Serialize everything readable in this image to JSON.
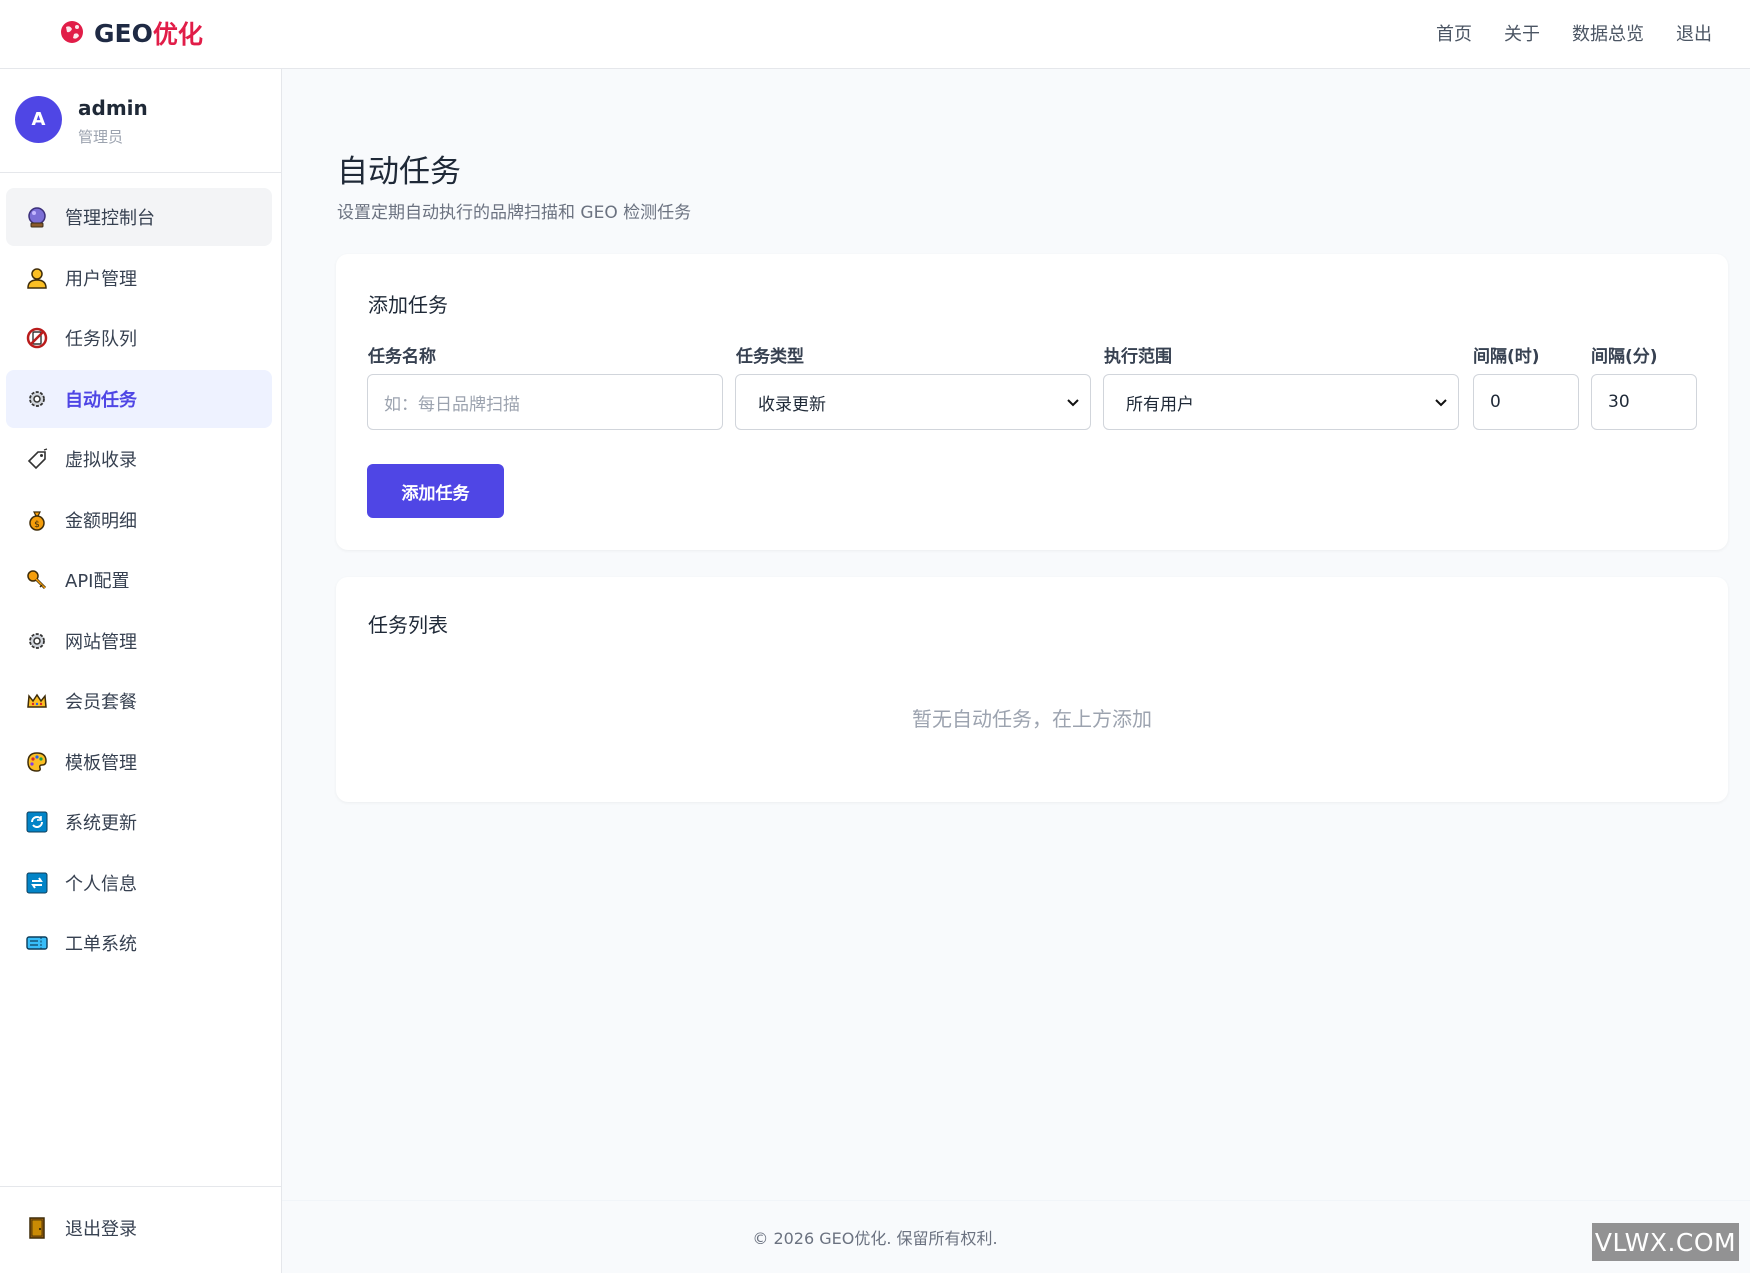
{
  "header": {
    "logo_text": "GEO",
    "logo_text_accent": "优化",
    "nav": [
      "首页",
      "关于",
      "数据总览",
      "退出"
    ]
  },
  "user": {
    "avatar_letter": "A",
    "name": "admin",
    "role": "管理员"
  },
  "sidebar": {
    "items": [
      {
        "label": "管理控制台",
        "icon": "crystal-ball-icon",
        "state": "hover"
      },
      {
        "label": "用户管理",
        "icon": "user-icon",
        "state": ""
      },
      {
        "label": "任务队列",
        "icon": "no-entry-icon",
        "state": ""
      },
      {
        "label": "自动任务",
        "icon": "gear-icon",
        "state": "active"
      },
      {
        "label": "虚拟收录",
        "icon": "tag-icon",
        "state": ""
      },
      {
        "label": "金额明细",
        "icon": "money-bag-icon",
        "state": ""
      },
      {
        "label": "API配置",
        "icon": "key-icon",
        "state": ""
      },
      {
        "label": "网站管理",
        "icon": "gear-icon",
        "state": ""
      },
      {
        "label": "会员套餐",
        "icon": "crown-icon",
        "state": ""
      },
      {
        "label": "模板管理",
        "icon": "palette-icon",
        "state": ""
      },
      {
        "label": "系统更新",
        "icon": "refresh-icon",
        "state": ""
      },
      {
        "label": "个人信息",
        "icon": "repeat-icon",
        "state": ""
      },
      {
        "label": "工单系统",
        "icon": "ticket-icon",
        "state": ""
      }
    ],
    "logout_label": "退出登录"
  },
  "main": {
    "title": "自动任务",
    "subtitle": "设置定期自动执行的品牌扫描和 GEO 检测任务",
    "add_card": {
      "title": "添加任务",
      "task_name_label": "任务名称",
      "task_name_placeholder": "如：每日品牌扫描",
      "task_type_label": "任务类型",
      "task_type_value": "收录更新",
      "scope_label": "执行范围",
      "scope_value": "所有用户",
      "hours_label": "间隔(时)",
      "hours_value": "0",
      "minutes_label": "间隔(分)",
      "minutes_value": "30",
      "submit_label": "添加任务"
    },
    "list_card": {
      "title": "任务列表",
      "empty_text": "暂无自动任务，在上方添加"
    }
  },
  "footer": {
    "text": "© 2026 GEO优化. 保留所有权利."
  },
  "watermark": "VLWX.COM",
  "colors": {
    "accent": "#4f46e5",
    "brand_red": "#e11d48",
    "active_bg": "#eef2ff"
  }
}
